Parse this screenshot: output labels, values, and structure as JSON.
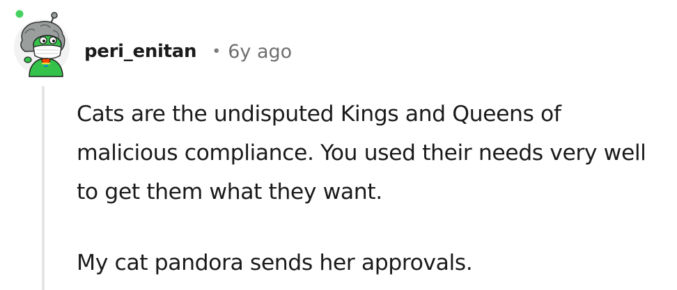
{
  "comment": {
    "author": "peri_enitan",
    "separator": "•",
    "timestamp": "6y ago",
    "avatar_icon": "snoo-avatar-icon",
    "online_color": "#46d160",
    "paragraphs": [
      "Cats are the undisputed Kings and Queens of malicious compliance. You used their needs very well to get them what they want.",
      "My cat pandora sends her approvals."
    ]
  }
}
